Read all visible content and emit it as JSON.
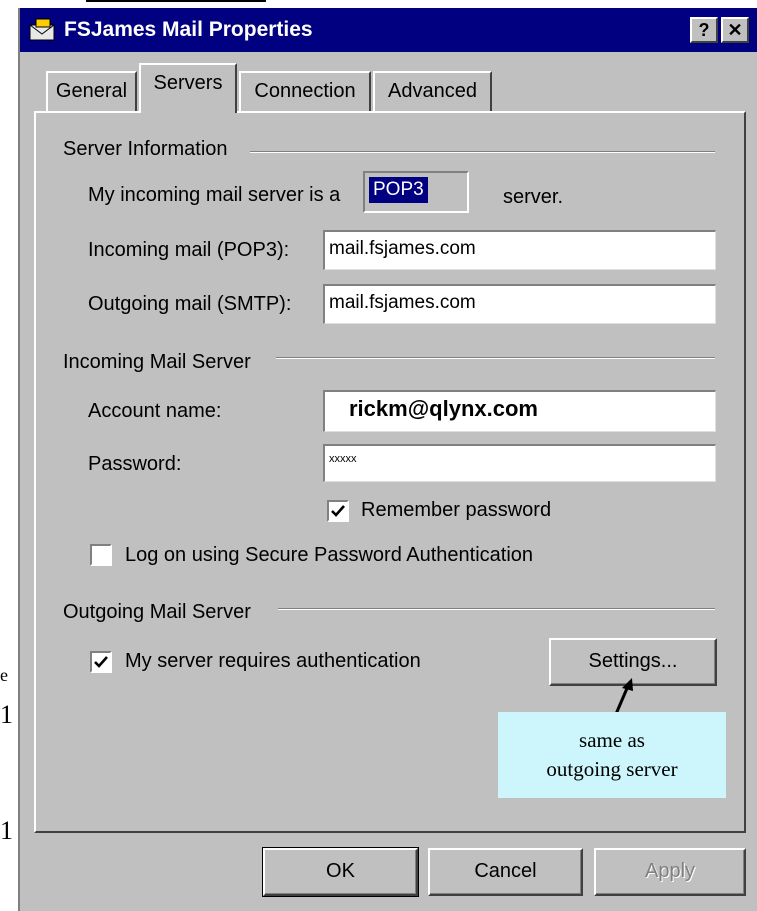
{
  "window": {
    "title": "FSJames Mail Properties",
    "help_button": "?",
    "close_button": "✕"
  },
  "tabs": [
    {
      "label": "General"
    },
    {
      "label": "Servers"
    },
    {
      "label": "Connection"
    },
    {
      "label": "Advanced"
    }
  ],
  "server_info": {
    "group_label": "Server Information",
    "incoming_type_prefix": "My incoming mail server is a",
    "incoming_type_value": "POP3",
    "incoming_type_suffix": "server.",
    "incoming_label": "Incoming mail (POP3):",
    "incoming_value": "mail.fsjames.com",
    "outgoing_label": "Outgoing mail (SMTP):",
    "outgoing_value": "mail.fsjames.com"
  },
  "incoming_server": {
    "group_label": "Incoming Mail Server",
    "account_label": "Account name:",
    "account_value": "rickm@qlynx.com",
    "password_label": "Password:",
    "password_value": "xxxxx",
    "remember_label": "Remember password",
    "remember_checked": true,
    "spa_label": "Log on using Secure Password Authentication",
    "spa_checked": false
  },
  "outgoing_server": {
    "group_label": "Outgoing Mail Server",
    "auth_label": "My server requires authentication",
    "auth_checked": true,
    "settings_button": "Settings..."
  },
  "annotation": {
    "line1": "same as",
    "line2": "outgoing server"
  },
  "footer": {
    "ok": "OK",
    "cancel": "Cancel",
    "apply": "Apply"
  },
  "background_marks": [
    "e",
    "1",
    "1"
  ],
  "colors": {
    "title_bar": "#000080",
    "face": "#c0c0c0",
    "callout": "#ccf5fc"
  }
}
